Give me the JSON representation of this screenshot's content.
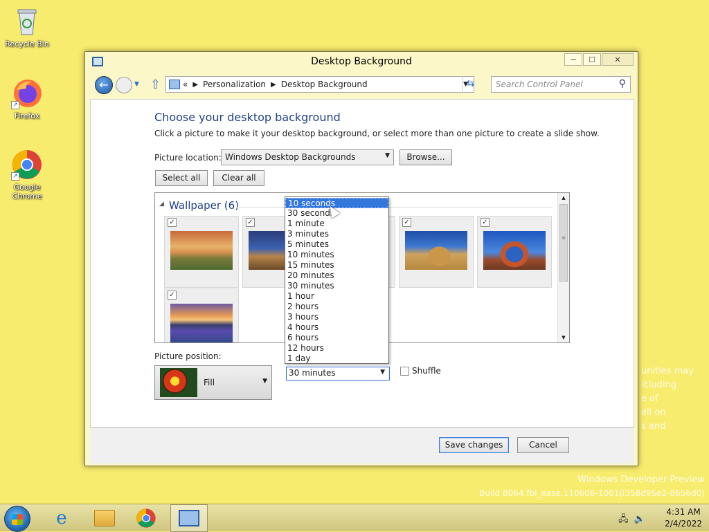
{
  "desktop": {
    "icons": [
      {
        "label": "Recycle Bin"
      },
      {
        "label": "Firefox"
      },
      {
        "label": "Google Chrome"
      }
    ],
    "watermark": {
      "line1": "Windows Developer Preview",
      "line2": "Build 8064.fbl_ease.110606-1001(l358d95e2-8656d0)",
      "obscured_fragments": [
        "unities may",
        "lcluding",
        "e of",
        "ell on",
        "s and"
      ]
    }
  },
  "window": {
    "title": "Desktop Background",
    "controls": {
      "minimize": "─",
      "maximize": "☐",
      "close": "✕"
    },
    "address": {
      "prefix": "«",
      "crumbs": [
        "Personalization",
        "Desktop Background"
      ]
    },
    "search": {
      "placeholder": "Search Control Panel"
    },
    "heading": "Choose your desktop background",
    "description": "Click a picture to make it your desktop background, or select more than one picture to create a slide show.",
    "picture_location": {
      "label": "Picture location:",
      "value": "Windows Desktop Backgrounds",
      "browse": "Browse..."
    },
    "select_all": "Select all",
    "clear_all": "Clear all",
    "gallery": {
      "group_title": "Wallpaper (6)",
      "items": [
        {
          "checked": true,
          "name": "wallpaper-sunset-field"
        },
        {
          "checked": true,
          "name": "wallpaper-coast"
        },
        {
          "checked": true,
          "name": "wallpaper-hidden"
        },
        {
          "checked": true,
          "name": "wallpaper-hay-bale"
        },
        {
          "checked": true,
          "name": "wallpaper-arch"
        },
        {
          "checked": true,
          "name": "wallpaper-lake-flowers"
        }
      ]
    },
    "picture_position": {
      "label": "Picture position:",
      "value": "Fill"
    },
    "interval": {
      "value": "30 minutes",
      "options": [
        "10 seconds",
        "30 seconds",
        "1 minute",
        "3 minutes",
        "5 minutes",
        "10 minutes",
        "15 minutes",
        "20 minutes",
        "30 minutes",
        "1 hour",
        "2 hours",
        "3 hours",
        "4 hours",
        "6 hours",
        "12 hours",
        "1 day"
      ],
      "highlighted": "10 seconds"
    },
    "shuffle": {
      "label": "Shuffle",
      "checked": false
    },
    "save_button": "Save changes",
    "cancel_button": "Cancel"
  },
  "taskbar": {
    "items": [
      "start",
      "internet-explorer",
      "file-explorer",
      "google-chrome",
      "control-panel"
    ],
    "clock": {
      "time": "4:31 AM",
      "date": "2/4/2022"
    }
  }
}
